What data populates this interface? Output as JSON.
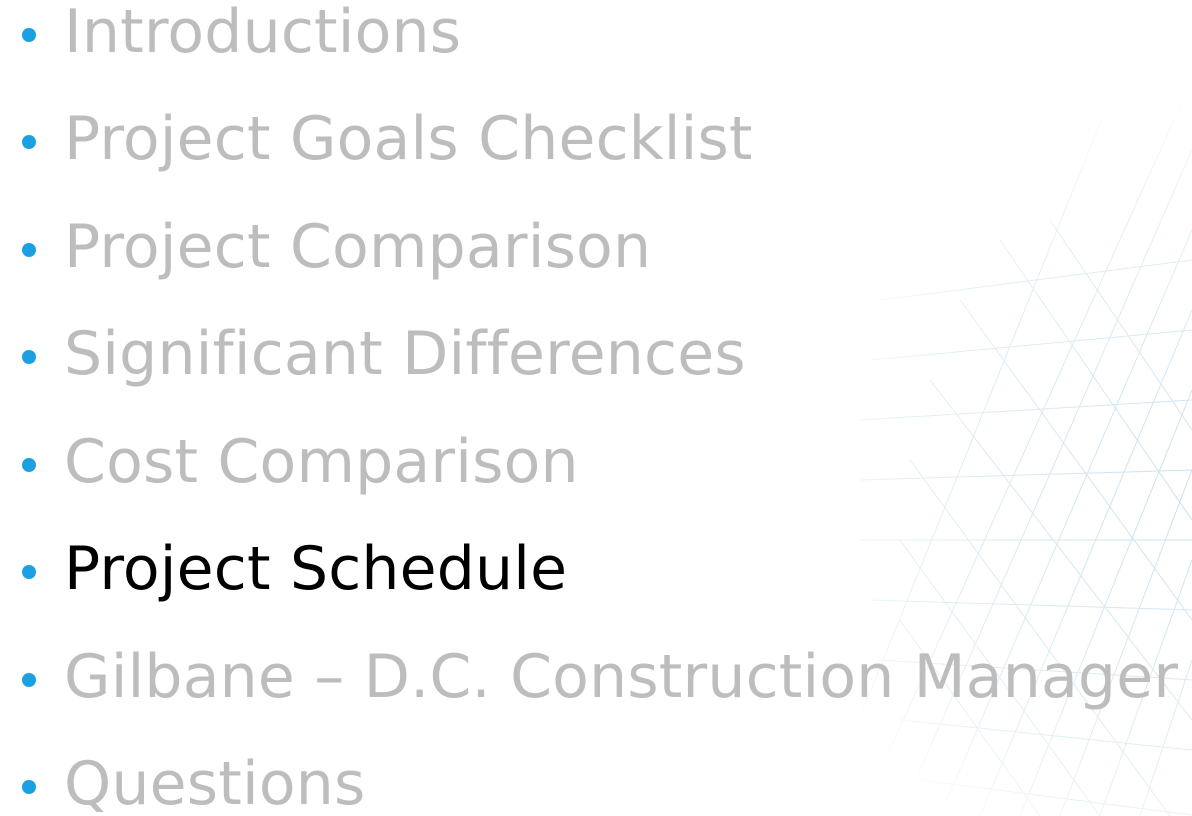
{
  "slide": {
    "bullet_color": "#1ba1e2",
    "inactive_text_color": "#bdbdbd",
    "active_text_color": "#000000",
    "agenda": [
      {
        "label": "Introductions",
        "active": false
      },
      {
        "label": "Project Goals Checklist",
        "active": false
      },
      {
        "label": "Project Comparison",
        "active": false
      },
      {
        "label": "Significant Differences",
        "active": false
      },
      {
        "label": "Cost Comparison",
        "active": false
      },
      {
        "label": "Project Schedule",
        "active": true
      },
      {
        "label": "Gilbane – D.C. Construction Manager",
        "active": false
      },
      {
        "label": "Questions",
        "active": false
      }
    ]
  }
}
